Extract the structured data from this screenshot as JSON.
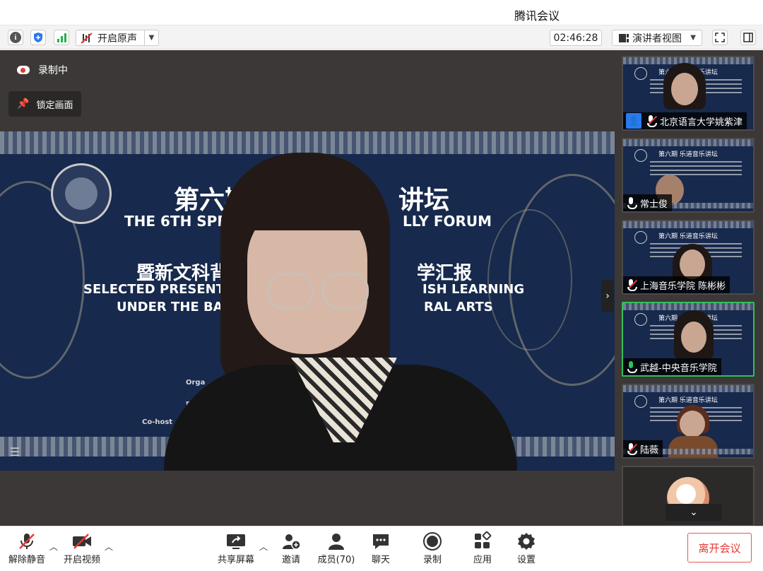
{
  "window": {
    "title": "腾讯会议"
  },
  "toolbar": {
    "original_sound_label": "开启原声",
    "clock": "02:46:28",
    "view_label": "演讲者视图"
  },
  "stage": {
    "recording_label": "录制中",
    "lock_label": "锁定画面",
    "slide": {
      "zh_title_a": "第六期",
      "zh_title_b": "讲坛",
      "en_title_a": "THE 6TH SPEAKI",
      "en_title_b": "LLY FORUM",
      "zh_sub_a": "暨新文科背",
      "zh_sub_b": "学汇报",
      "en_sub1_a": "SELECTED PRESENT",
      "en_sub1_b": "ISH LEARNING",
      "en_sub2_a": "UNDER THE BAC",
      "en_sub2_b": "RAL ARTS",
      "line1": "Orga",
      "line2": "联合",
      "line3": "Co-host"
    }
  },
  "sidebar": {
    "tile_slide_title": "第六期 乐道音乐讲坛",
    "participants": [
      {
        "name": "北京语言大学姚紫津",
        "mic": "muted",
        "host": true
      },
      {
        "name": "常士俊",
        "mic": "on",
        "host": false
      },
      {
        "name": "上海音乐学院 陈彬彬",
        "mic": "muted",
        "host": false
      },
      {
        "name": "武越-中央音乐学院",
        "mic": "speaking",
        "host": false
      },
      {
        "name": "陆薇",
        "mic": "muted",
        "host": false
      }
    ]
  },
  "bottombar": {
    "unmute": "解除静音",
    "video": "开启视频",
    "share": "共享屏幕",
    "invite": "邀请",
    "members": "成员(70)",
    "chat": "聊天",
    "record": "录制",
    "apps": "应用",
    "settings": "设置",
    "leave": "离开会议"
  },
  "colors": {
    "accent_blue": "#2b78f0",
    "leave_red": "#e53935",
    "speaking_green": "#2fc15a",
    "stage_bg": "#3b3837"
  },
  "icons": [
    "info-icon",
    "shield-icon",
    "signal-icon",
    "mic-off-icon",
    "fullscreen-icon",
    "sidebar-toggle-icon",
    "cloud-record-icon",
    "pin-icon",
    "chevron-right-icon",
    "chevron-down-icon",
    "share-screen-icon",
    "add-user-icon",
    "members-icon",
    "chat-icon",
    "record-icon",
    "apps-icon",
    "gear-icon"
  ]
}
